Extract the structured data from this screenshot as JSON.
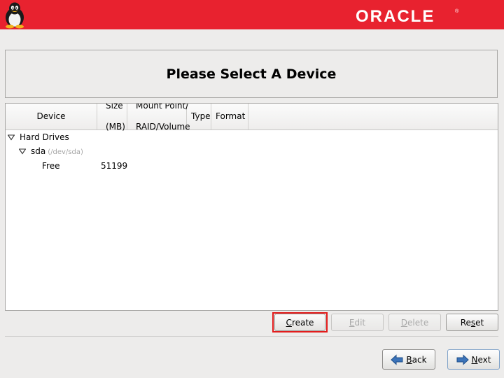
{
  "header": {
    "logo_text": "ORACLE",
    "brand_color": "#e8222f",
    "icons": [
      "tux-penguin-icon",
      "oracle-logo"
    ]
  },
  "page": {
    "title": "Please Select A Device"
  },
  "table": {
    "columns": [
      {
        "line1": "Device",
        "line2": ""
      },
      {
        "line1": "Size",
        "line2": "(MB)"
      },
      {
        "line1": "Mount Point/",
        "line2": "RAID/Volume"
      },
      {
        "line1": "Type",
        "line2": ""
      },
      {
        "line1": "Format",
        "line2": ""
      }
    ],
    "rows": {
      "hard_drives": {
        "label": "Hard Drives"
      },
      "sda": {
        "label": "sda",
        "path": "(/dev/sda)"
      },
      "free": {
        "label": "Free",
        "size": "51199"
      }
    }
  },
  "actions": {
    "create": {
      "prefix": "",
      "accel": "C",
      "rest": "reate"
    },
    "edit": {
      "prefix": "",
      "accel": "E",
      "rest": "dit"
    },
    "delete": {
      "prefix": "",
      "accel": "D",
      "rest": "elete"
    },
    "reset": {
      "prefix": "Re",
      "accel": "s",
      "rest": "et"
    }
  },
  "navigation": {
    "back": {
      "accel": "B",
      "rest": "ack"
    },
    "next": {
      "accel": "N",
      "rest": "ext"
    }
  }
}
